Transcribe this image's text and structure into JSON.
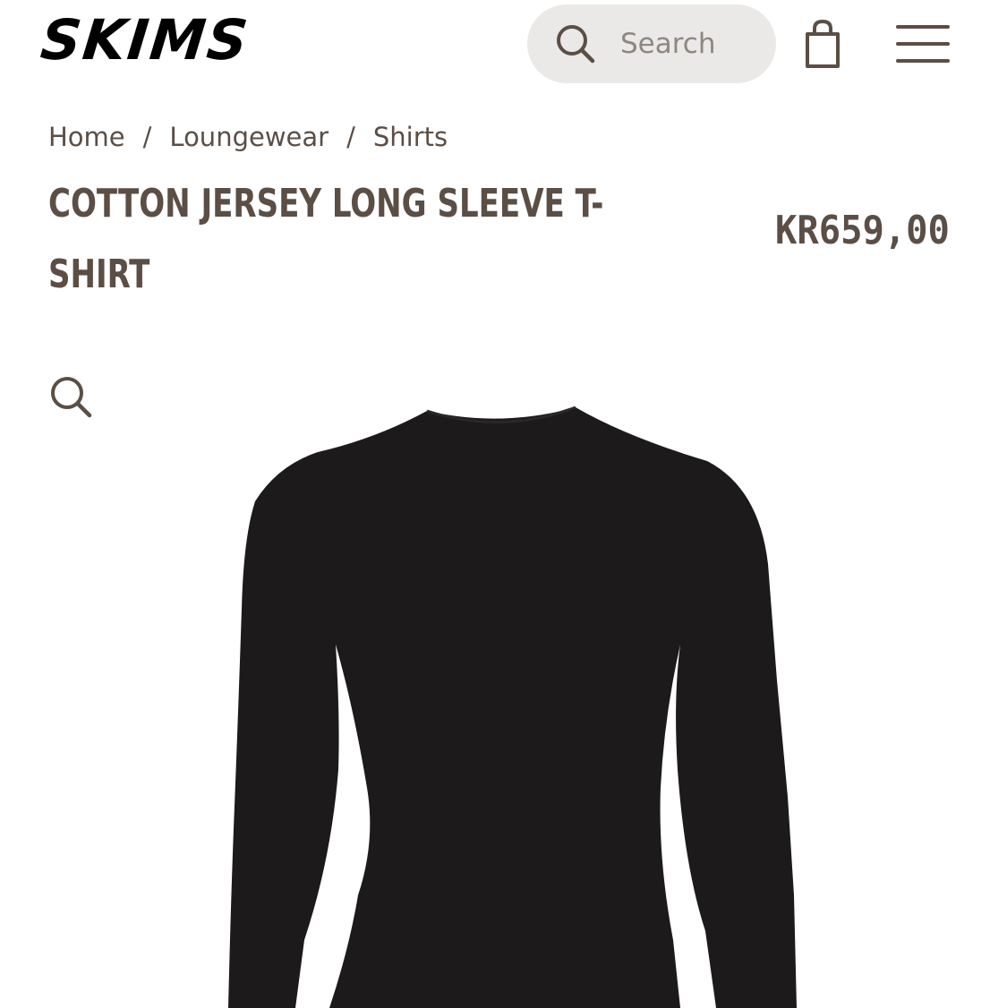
{
  "header": {
    "logo_text": "SKIMS",
    "search_placeholder": "Search",
    "icons": {
      "search": "search-icon",
      "bag": "shopping-bag-icon",
      "menu": "hamburger-menu-icon"
    }
  },
  "breadcrumb": {
    "items": [
      "Home",
      "Loungewear",
      "Shirts"
    ],
    "separator": "/"
  },
  "product": {
    "title": "COTTON JERSEY LONG SLEEVE T-SHIRT",
    "price": "KR659,00",
    "image_alt_icon": "zoom-icon"
  },
  "colors": {
    "text": "#5b4e45",
    "search_bg": "#ebe9e7",
    "search_text": "#8e8780",
    "garment": "#1c1a1a"
  }
}
